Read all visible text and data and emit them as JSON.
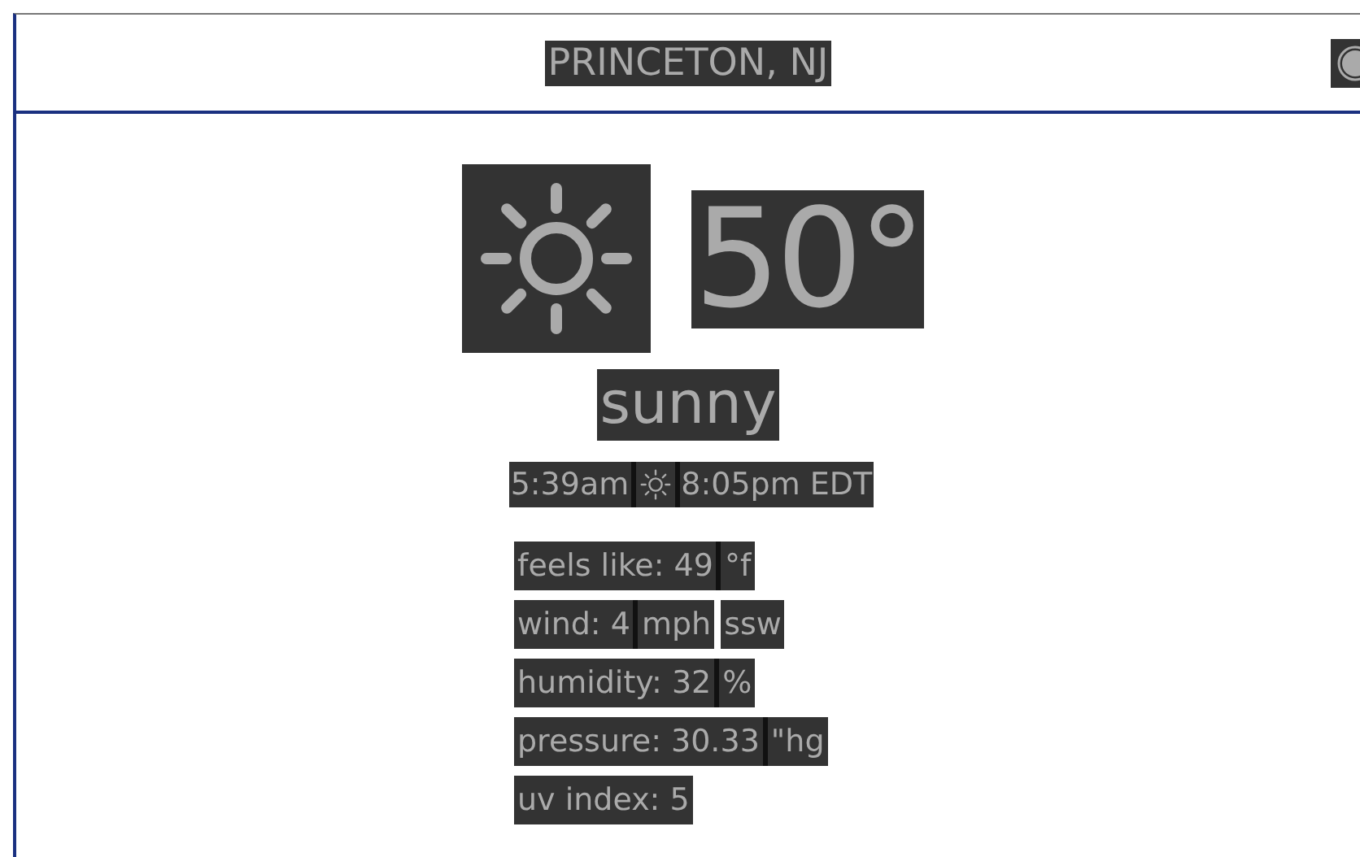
{
  "header": {
    "location": "PRINCETON, NJ"
  },
  "current": {
    "temperature": "50°",
    "condition": "sunny"
  },
  "sun": {
    "sunrise": "5:39am",
    "sunset": "8:05pm EDT"
  },
  "details": [
    {
      "value": "feels like: 49",
      "unit": "°f"
    },
    {
      "value": "wind: 4",
      "unit": "mph",
      "direction": "ssw"
    },
    {
      "value": "humidity: 32",
      "unit": "%"
    },
    {
      "value": "pressure: 30.33",
      "unit": "\"hg"
    },
    {
      "value": "uv index: 5"
    }
  ]
}
